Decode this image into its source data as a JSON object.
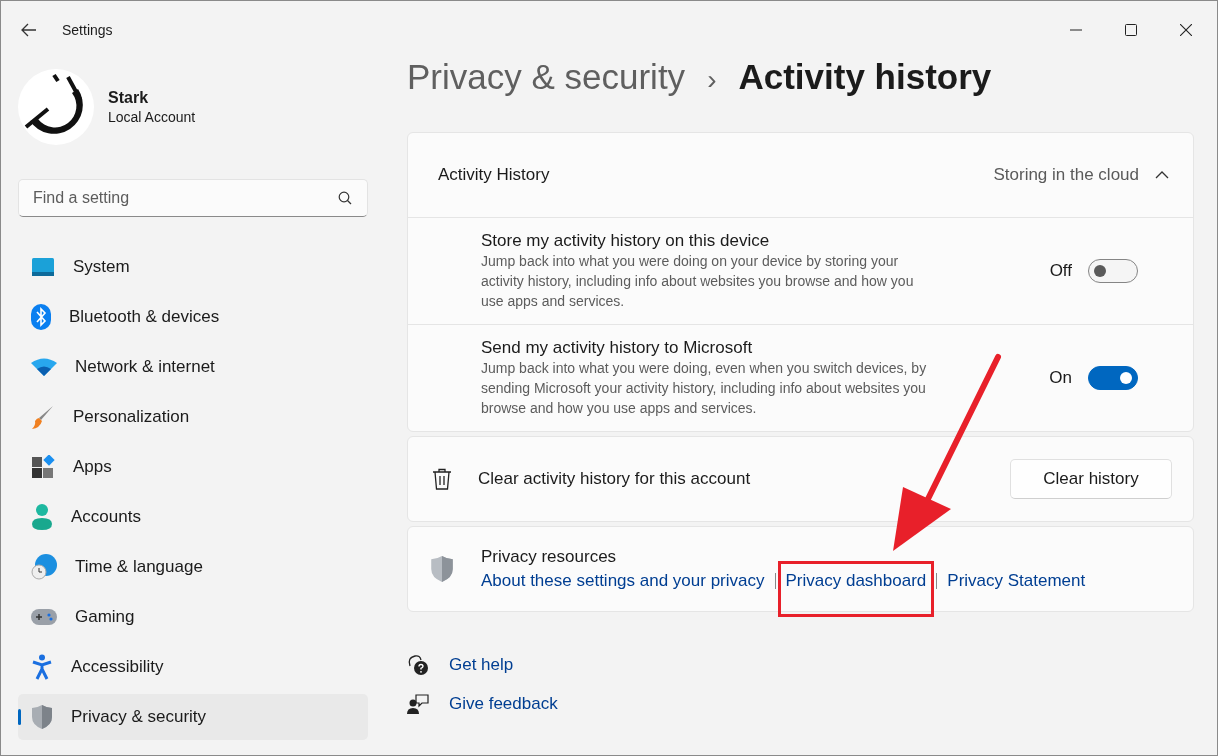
{
  "window": {
    "title": "Settings"
  },
  "profile": {
    "name": "Stark",
    "account_type": "Local Account"
  },
  "search": {
    "placeholder": "Find a setting"
  },
  "sidebar": {
    "items": [
      {
        "label": "System",
        "selected": false
      },
      {
        "label": "Bluetooth & devices",
        "selected": false
      },
      {
        "label": "Network & internet",
        "selected": false
      },
      {
        "label": "Personalization",
        "selected": false
      },
      {
        "label": "Apps",
        "selected": false
      },
      {
        "label": "Accounts",
        "selected": false
      },
      {
        "label": "Time & language",
        "selected": false
      },
      {
        "label": "Gaming",
        "selected": false
      },
      {
        "label": "Accessibility",
        "selected": false
      },
      {
        "label": "Privacy & security",
        "selected": true
      }
    ]
  },
  "breadcrumb": {
    "parent": "Privacy & security",
    "separator": "›",
    "current": "Activity history"
  },
  "activity_card": {
    "title": "Activity History",
    "status": "Storing in the cloud",
    "expanded": true,
    "settings": [
      {
        "title": "Store my activity history on this device",
        "description": "Jump back into what you were doing on your device by storing your activity history, including info about websites you browse and how you use apps and services.",
        "state_label": "Off",
        "on": false
      },
      {
        "title": "Send my activity history to Microsoft",
        "description": "Jump back into what you were doing, even when you switch devices, by sending Microsoft your activity history, including info about websites you browse and how you use apps and services.",
        "state_label": "On",
        "on": true
      }
    ]
  },
  "clear_card": {
    "label": "Clear activity history for this account",
    "button": "Clear history"
  },
  "resources_card": {
    "title": "Privacy resources",
    "links": [
      "About these settings and your privacy",
      "Privacy dashboard",
      "Privacy Statement"
    ]
  },
  "help_links": [
    "Get help",
    "Give feedback"
  ]
}
